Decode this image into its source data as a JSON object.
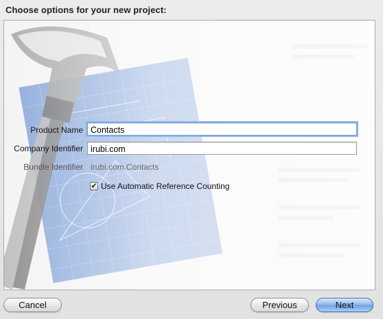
{
  "dialog": {
    "heading": "Choose options for your new project:"
  },
  "form": {
    "product_name": {
      "label": "Product Name",
      "value": "Contacts"
    },
    "company_identifier": {
      "label": "Company Identifier",
      "value": "irubi.com"
    },
    "bundle_identifier": {
      "label": "Bundle Identifier",
      "value": "irubi.com.Contacts"
    },
    "arc_checkbox": {
      "label": "Use Automatic Reference Counting",
      "checked": true,
      "glyph": "✔"
    }
  },
  "buttons": {
    "cancel": "Cancel",
    "previous": "Previous",
    "next": "Next"
  },
  "colors": {
    "focus_ring": "#8fb6ea",
    "primary_button": "#6e9fe6",
    "blueprint": "#3f73c9"
  },
  "icons": {
    "background": "xcode-hammer-blueprint-icon"
  }
}
